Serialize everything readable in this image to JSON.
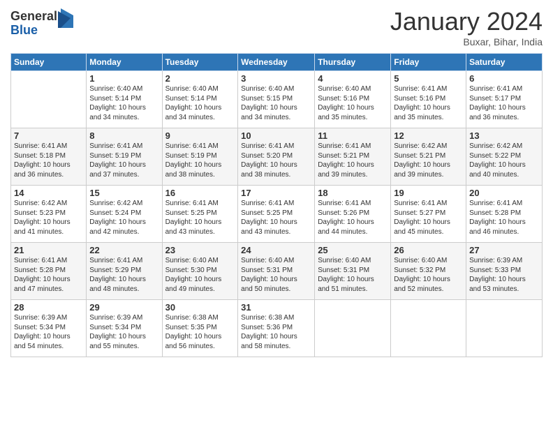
{
  "header": {
    "logo_general": "General",
    "logo_blue": "Blue",
    "month_title": "January 2024",
    "subtitle": "Buxar, Bihar, India"
  },
  "weekdays": [
    "Sunday",
    "Monday",
    "Tuesday",
    "Wednesday",
    "Thursday",
    "Friday",
    "Saturday"
  ],
  "weeks": [
    [
      {
        "day": "",
        "info": ""
      },
      {
        "day": "1",
        "info": "Sunrise: 6:40 AM\nSunset: 5:14 PM\nDaylight: 10 hours\nand 34 minutes."
      },
      {
        "day": "2",
        "info": "Sunrise: 6:40 AM\nSunset: 5:14 PM\nDaylight: 10 hours\nand 34 minutes."
      },
      {
        "day": "3",
        "info": "Sunrise: 6:40 AM\nSunset: 5:15 PM\nDaylight: 10 hours\nand 34 minutes."
      },
      {
        "day": "4",
        "info": "Sunrise: 6:40 AM\nSunset: 5:16 PM\nDaylight: 10 hours\nand 35 minutes."
      },
      {
        "day": "5",
        "info": "Sunrise: 6:41 AM\nSunset: 5:16 PM\nDaylight: 10 hours\nand 35 minutes."
      },
      {
        "day": "6",
        "info": "Sunrise: 6:41 AM\nSunset: 5:17 PM\nDaylight: 10 hours\nand 36 minutes."
      }
    ],
    [
      {
        "day": "7",
        "info": "Sunrise: 6:41 AM\nSunset: 5:18 PM\nDaylight: 10 hours\nand 36 minutes."
      },
      {
        "day": "8",
        "info": "Sunrise: 6:41 AM\nSunset: 5:19 PM\nDaylight: 10 hours\nand 37 minutes."
      },
      {
        "day": "9",
        "info": "Sunrise: 6:41 AM\nSunset: 5:19 PM\nDaylight: 10 hours\nand 38 minutes."
      },
      {
        "day": "10",
        "info": "Sunrise: 6:41 AM\nSunset: 5:20 PM\nDaylight: 10 hours\nand 38 minutes."
      },
      {
        "day": "11",
        "info": "Sunrise: 6:41 AM\nSunset: 5:21 PM\nDaylight: 10 hours\nand 39 minutes."
      },
      {
        "day": "12",
        "info": "Sunrise: 6:42 AM\nSunset: 5:21 PM\nDaylight: 10 hours\nand 39 minutes."
      },
      {
        "day": "13",
        "info": "Sunrise: 6:42 AM\nSunset: 5:22 PM\nDaylight: 10 hours\nand 40 minutes."
      }
    ],
    [
      {
        "day": "14",
        "info": "Sunrise: 6:42 AM\nSunset: 5:23 PM\nDaylight: 10 hours\nand 41 minutes."
      },
      {
        "day": "15",
        "info": "Sunrise: 6:42 AM\nSunset: 5:24 PM\nDaylight: 10 hours\nand 42 minutes."
      },
      {
        "day": "16",
        "info": "Sunrise: 6:41 AM\nSunset: 5:25 PM\nDaylight: 10 hours\nand 43 minutes."
      },
      {
        "day": "17",
        "info": "Sunrise: 6:41 AM\nSunset: 5:25 PM\nDaylight: 10 hours\nand 43 minutes."
      },
      {
        "day": "18",
        "info": "Sunrise: 6:41 AM\nSunset: 5:26 PM\nDaylight: 10 hours\nand 44 minutes."
      },
      {
        "day": "19",
        "info": "Sunrise: 6:41 AM\nSunset: 5:27 PM\nDaylight: 10 hours\nand 45 minutes."
      },
      {
        "day": "20",
        "info": "Sunrise: 6:41 AM\nSunset: 5:28 PM\nDaylight: 10 hours\nand 46 minutes."
      }
    ],
    [
      {
        "day": "21",
        "info": "Sunrise: 6:41 AM\nSunset: 5:28 PM\nDaylight: 10 hours\nand 47 minutes."
      },
      {
        "day": "22",
        "info": "Sunrise: 6:41 AM\nSunset: 5:29 PM\nDaylight: 10 hours\nand 48 minutes."
      },
      {
        "day": "23",
        "info": "Sunrise: 6:40 AM\nSunset: 5:30 PM\nDaylight: 10 hours\nand 49 minutes."
      },
      {
        "day": "24",
        "info": "Sunrise: 6:40 AM\nSunset: 5:31 PM\nDaylight: 10 hours\nand 50 minutes."
      },
      {
        "day": "25",
        "info": "Sunrise: 6:40 AM\nSunset: 5:31 PM\nDaylight: 10 hours\nand 51 minutes."
      },
      {
        "day": "26",
        "info": "Sunrise: 6:40 AM\nSunset: 5:32 PM\nDaylight: 10 hours\nand 52 minutes."
      },
      {
        "day": "27",
        "info": "Sunrise: 6:39 AM\nSunset: 5:33 PM\nDaylight: 10 hours\nand 53 minutes."
      }
    ],
    [
      {
        "day": "28",
        "info": "Sunrise: 6:39 AM\nSunset: 5:34 PM\nDaylight: 10 hours\nand 54 minutes."
      },
      {
        "day": "29",
        "info": "Sunrise: 6:39 AM\nSunset: 5:34 PM\nDaylight: 10 hours\nand 55 minutes."
      },
      {
        "day": "30",
        "info": "Sunrise: 6:38 AM\nSunset: 5:35 PM\nDaylight: 10 hours\nand 56 minutes."
      },
      {
        "day": "31",
        "info": "Sunrise: 6:38 AM\nSunset: 5:36 PM\nDaylight: 10 hours\nand 58 minutes."
      },
      {
        "day": "",
        "info": ""
      },
      {
        "day": "",
        "info": ""
      },
      {
        "day": "",
        "info": ""
      }
    ]
  ]
}
